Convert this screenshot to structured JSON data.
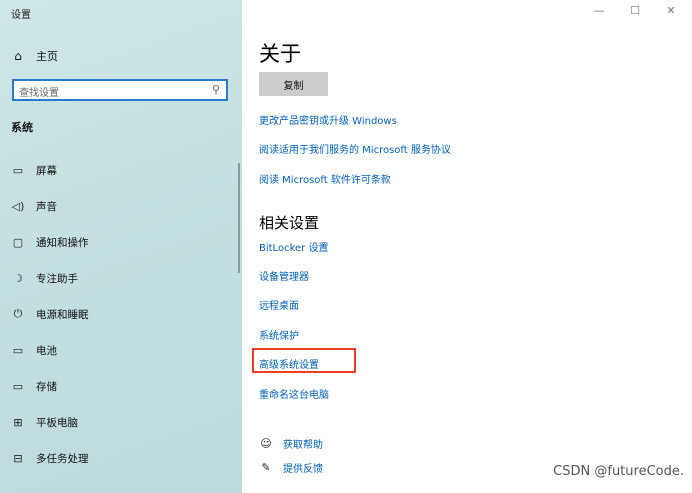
{
  "window": {
    "title": "设置",
    "controls": {
      "minimize": "—",
      "maximize": "☐",
      "close": "✕"
    }
  },
  "sidebar": {
    "home_label": "主页",
    "home_icon": "home-icon",
    "search_placeholder": "查找设置",
    "section_label": "系统",
    "items": [
      {
        "label": "屏幕",
        "icon": "monitor-icon",
        "glyph": "▭"
      },
      {
        "label": "声音",
        "icon": "speaker-icon",
        "glyph": "◁)"
      },
      {
        "label": "通知和操作",
        "icon": "notification-icon",
        "glyph": "▢"
      },
      {
        "label": "专注助手",
        "icon": "moon-icon",
        "glyph": "☽"
      },
      {
        "label": "电源和睡眠",
        "icon": "power-icon",
        "glyph": "⏻"
      },
      {
        "label": "电池",
        "icon": "battery-icon",
        "glyph": "▭"
      },
      {
        "label": "存储",
        "icon": "storage-icon",
        "glyph": "▭"
      },
      {
        "label": "平板电脑",
        "icon": "tablet-icon",
        "glyph": "⊞"
      },
      {
        "label": "多任务处理",
        "icon": "multitask-icon",
        "glyph": "⊟"
      }
    ]
  },
  "main": {
    "title": "关于",
    "copy_button": "复制",
    "about_links": [
      "更改产品密钥或升级 Windows",
      "阅读适用于我们服务的 Microsoft 服务协议",
      "阅读 Microsoft 软件许可条款"
    ],
    "related_title": "相关设置",
    "related_links": [
      "BitLocker 设置",
      "设备管理器",
      "远程桌面",
      "系统保护",
      "高级系统设置",
      "重命名这台电脑"
    ],
    "help": [
      {
        "label": "获取帮助",
        "icon": "help-chat-icon",
        "glyph": "☺"
      },
      {
        "label": "提供反馈",
        "icon": "feedback-icon",
        "glyph": "✎"
      }
    ]
  },
  "watermark": "CSDN @futureCode."
}
